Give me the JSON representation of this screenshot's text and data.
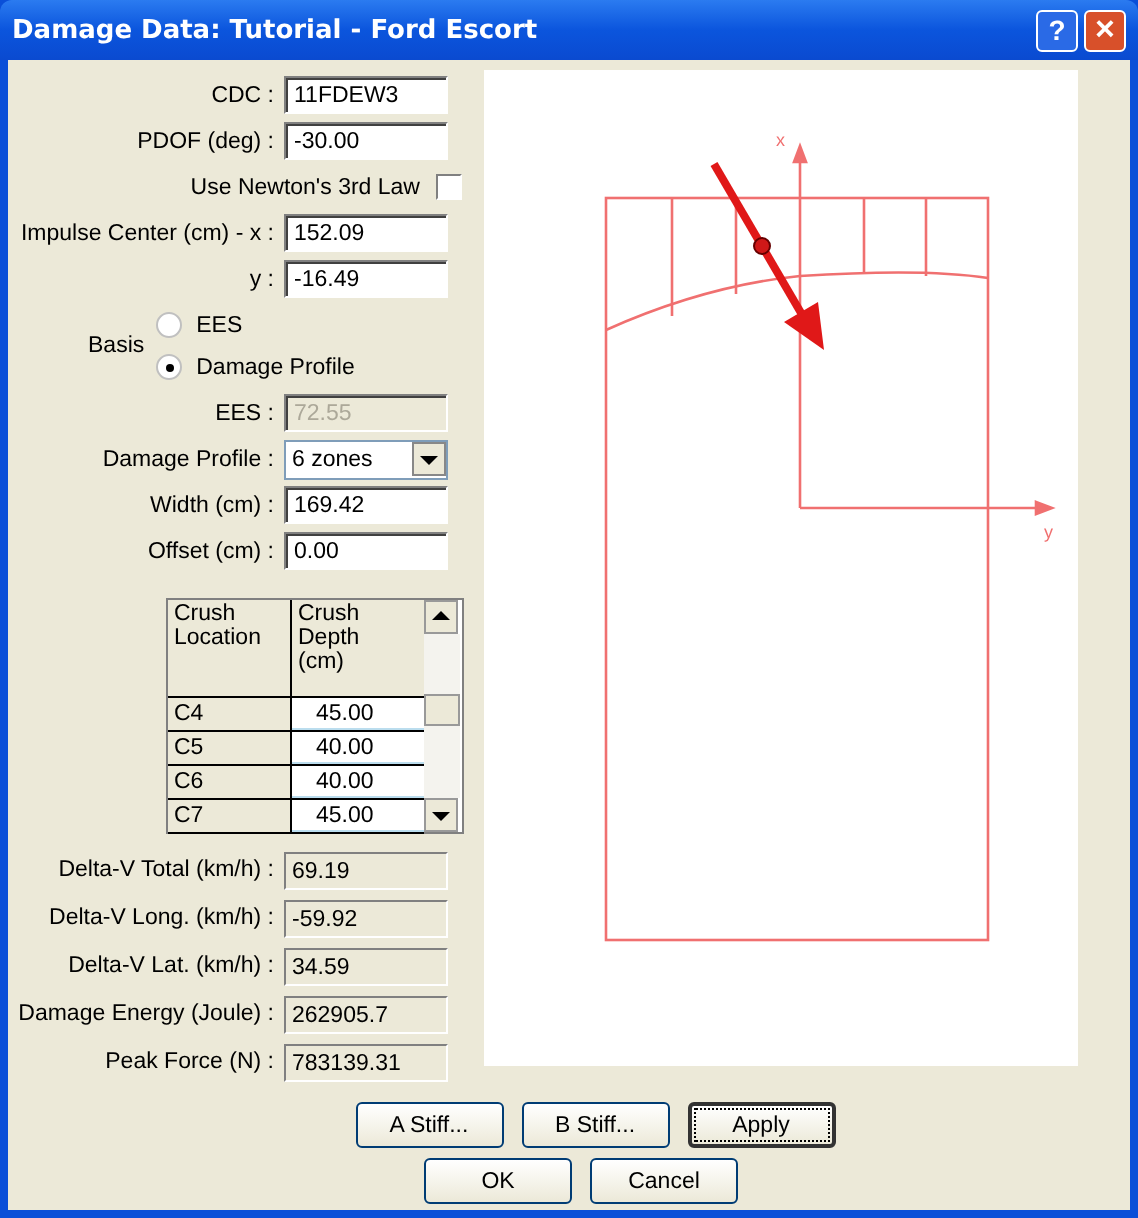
{
  "window": {
    "title": "Damage Data: Tutorial - Ford Escort",
    "help": "?",
    "close": "×"
  },
  "form": [
    {
      "kind": "input",
      "label": "CDC :",
      "value": "11FDEW3",
      "disabled": false
    },
    {
      "kind": "input",
      "label": "PDOF (deg) :",
      "value": "-30.00",
      "disabled": false
    },
    {
      "kind": "checkbox",
      "label": "Use Newton's 3rd Law",
      "checked": false
    },
    {
      "kind": "input",
      "label": "Impulse Center (cm) - x :",
      "value": "152.09",
      "disabled": false
    },
    {
      "kind": "input",
      "label": "y :",
      "value": "-16.49",
      "disabled": false
    },
    {
      "kind": "radio",
      "label": "Basis",
      "options": [
        {
          "label": "EES",
          "selected": false
        },
        {
          "label": "Damage Profile",
          "selected": true
        }
      ]
    },
    {
      "kind": "input",
      "label": "EES :",
      "value": "72.55",
      "disabled": true
    },
    {
      "kind": "select",
      "label": "Damage Profile :",
      "value": "6 zones"
    },
    {
      "kind": "input",
      "label": "Width (cm) :",
      "value": "169.42",
      "disabled": false
    },
    {
      "kind": "input",
      "label": "Offset (cm) :",
      "value": "0.00",
      "disabled": false
    }
  ],
  "crush_table": {
    "columns": [
      "Crush Location",
      "Crush Depth (cm)"
    ],
    "rows": [
      {
        "location": "C4",
        "depth": "45.00"
      },
      {
        "location": "C5",
        "depth": "40.00"
      },
      {
        "location": "C6",
        "depth": "40.00"
      },
      {
        "location": "C7",
        "depth": "45.00"
      }
    ]
  },
  "results": [
    {
      "label": "Delta-V Total (km/h) :",
      "value": "69.19"
    },
    {
      "label": "Delta-V Long. (km/h) :",
      "value": "-59.92"
    },
    {
      "label": "Delta-V Lat. (km/h) :",
      "value": "34.59"
    },
    {
      "label": "Damage Energy (Joule) :",
      "value": "262905.7"
    },
    {
      "label": "Peak Force (N) :",
      "value": "783139.31"
    }
  ],
  "diagram": {
    "x_axis_label": "x",
    "y_axis_label": "y"
  },
  "buttons": [
    [
      {
        "label": "A Stiff...",
        "focused": false
      },
      {
        "label": "B Stiff...",
        "focused": false
      },
      {
        "label": "Apply",
        "focused": true
      }
    ],
    [
      {
        "label": "OK",
        "focused": false
      },
      {
        "label": "Cancel",
        "focused": false
      }
    ]
  ]
}
